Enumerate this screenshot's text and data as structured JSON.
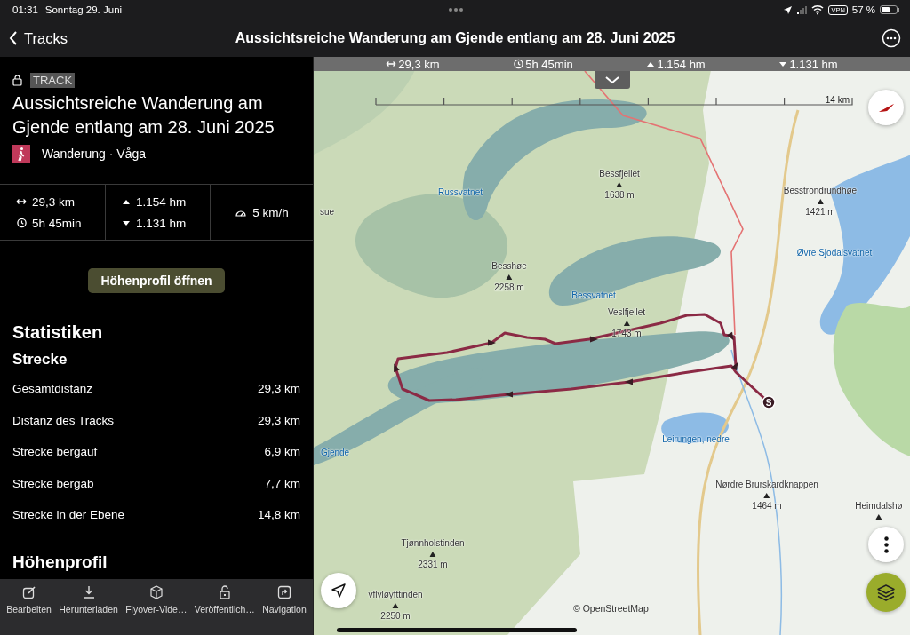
{
  "status_bar": {
    "time": "01:31",
    "date": "Sonntag 29. Juni",
    "vpn": "VPN",
    "battery": "57 %"
  },
  "nav_bar": {
    "back": "Tracks",
    "title": "Aussichtsreiche Wanderung am Gjende entlang am 28. Juni 2025"
  },
  "track": {
    "badge": "TRACK",
    "title": "Aussichtsreiche Wanderung am Gjende entlang am 28. Juni 2025",
    "activity": "Wanderung · Våga",
    "stats": [
      {
        "kind": "distance",
        "value": "29,3 km"
      },
      {
        "kind": "duration",
        "value": "5h 45min"
      },
      {
        "kind": "ascent",
        "value": "1.154 hm"
      },
      {
        "kind": "descent",
        "value": "1.131 hm"
      },
      {
        "kind": "speed",
        "value": "5 km/h"
      }
    ],
    "profile_button": "Höhenprofil öffnen",
    "section_title": "Statistiken",
    "subsection_title": "Strecke",
    "rows": [
      {
        "label": "Gesamtdistanz",
        "value": "29,3 km"
      },
      {
        "label": "Distanz des Tracks",
        "value": "29,3 km"
      },
      {
        "label": "Strecke bergauf",
        "value": "6,9 km"
      },
      {
        "label": "Strecke bergab",
        "value": "7,7 km"
      },
      {
        "label": "Strecke in der Ebene",
        "value": "14,8 km"
      }
    ],
    "next_section_title": "Höhenprofil"
  },
  "toolbar": [
    {
      "kind": "edit",
      "label": "Bearbeiten"
    },
    {
      "kind": "download",
      "label": "Herunterladen"
    },
    {
      "kind": "flyover",
      "label": "Flyover-Vide…"
    },
    {
      "kind": "publish",
      "label": "Veröffentlich…"
    },
    {
      "kind": "navigation",
      "label": "Navigation"
    }
  ],
  "map": {
    "summary": [
      {
        "kind": "distance",
        "value": "29,3 km"
      },
      {
        "kind": "duration",
        "value": "5h 45min"
      },
      {
        "kind": "ascent",
        "value": "1.154 hm"
      },
      {
        "kind": "descent",
        "value": "1.131 hm"
      }
    ],
    "scale": "14 km",
    "start_marker": "S",
    "attribution": "© OpenStreetMap",
    "labels": [
      {
        "kind": "water",
        "name": "Russvatnet"
      },
      {
        "kind": "place",
        "name": "sue"
      },
      {
        "kind": "peak",
        "name": "Bessfjellet",
        "elevation": "1638 m"
      },
      {
        "kind": "peak",
        "name": "Besstrondrundhøe",
        "elevation": "1421 m"
      },
      {
        "kind": "peak",
        "name": "Besshøe",
        "elevation": "2258 m"
      },
      {
        "kind": "water",
        "name": "Bessvatnet"
      },
      {
        "kind": "peak",
        "name": "Veslfjellet",
        "elevation": "1743 m"
      },
      {
        "kind": "water",
        "name": "Øvre Sjodalsvatnet"
      },
      {
        "kind": "water",
        "name": "Gjende"
      },
      {
        "kind": "water",
        "name": "Leirungen, nedre"
      },
      {
        "kind": "peak",
        "name": "Nørdre Brurskardknappen",
        "elevation": "1464 m"
      },
      {
        "kind": "peak",
        "name": "Heimdalshø"
      },
      {
        "kind": "peak",
        "name": "Tjønnholstinden",
        "elevation": "2331 m"
      },
      {
        "kind": "peak",
        "name": "vflyløyfttinden",
        "elevation": "2250 m"
      }
    ]
  }
}
